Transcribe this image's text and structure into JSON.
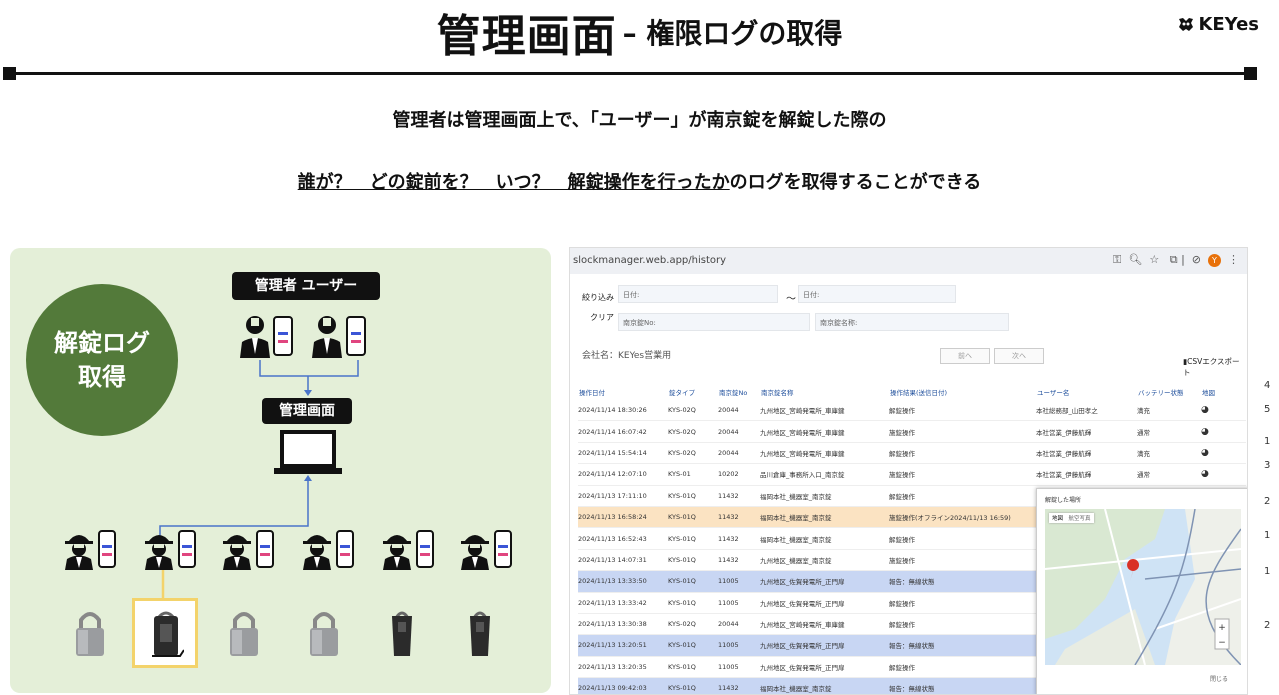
{
  "title": {
    "main": "管理画面",
    "sub": "– 権限ログの取得"
  },
  "brand": "KEYes",
  "intro": {
    "line1": "管理者は管理画面上で、「ユーザー」が南京錠を解錠した際の",
    "line2_underlined": "誰が？　どの錠前を？　いつ？　解錠操作を行ったか",
    "line2_rest": "のログを取得することができる"
  },
  "diagram": {
    "circle_line1": "解錠ログ",
    "circle_line2": "取得",
    "admin_label": "管理者 ユーザー",
    "screen_label": "管理画面"
  },
  "browser": {
    "url": "slockmanager.web.app/history",
    "avatar_letter": "Y",
    "filter_label": "絞り込み",
    "clear_label": "クリア",
    "date_label": "日付:",
    "tilde": "〜",
    "lock_no_label": "南京錠No:",
    "lock_name_label": "南京錠名称:",
    "company": "会社名：KEYes営業用",
    "prev": "前へ",
    "next": "次へ",
    "csv": "CSVエクスポート",
    "columns": [
      "操作日付",
      "錠タイプ",
      "南京錠No",
      "南京錠名称",
      "操作結果(送信日付)",
      "ユーザー名",
      "バッテリー状態",
      "地図"
    ],
    "rows": [
      {
        "date": "2024/11/14 18:30:26",
        "type": "KYS-02Q",
        "no": "20044",
        "name": "九州地区_宮崎発電所_車庫鍵",
        "result": "解錠操作",
        "user": "本社総務部_山田孝之",
        "battery": "満充",
        "style": ""
      },
      {
        "date": "2024/11/14 16:07:42",
        "type": "KYS-02Q",
        "no": "20044",
        "name": "九州地区_宮崎発電所_車庫鍵",
        "result": "施錠操作",
        "user": "本社営業_伊藤航輝",
        "battery": "通常",
        "style": ""
      },
      {
        "date": "2024/11/14 15:54:14",
        "type": "KYS-02Q",
        "no": "20044",
        "name": "九州地区_宮崎発電所_車庫鍵",
        "result": "解錠操作",
        "user": "本社営業_伊藤航輝",
        "battery": "満充",
        "style": ""
      },
      {
        "date": "2024/11/14 12:07:10",
        "type": "KYS-01",
        "no": "10202",
        "name": "品川倉庫_事務所入口_南京錠",
        "result": "施錠操作",
        "user": "本社営業_伊藤航輝",
        "battery": "通常",
        "style": ""
      },
      {
        "date": "2024/11/13 17:11:10",
        "type": "KYS-01Q",
        "no": "11432",
        "name": "福岡本社_機器室_南京錠",
        "result": "解錠操作",
        "user": "",
        "battery": "",
        "style": ""
      },
      {
        "date": "2024/11/13 16:58:24",
        "type": "KYS-01Q",
        "no": "11432",
        "name": "福岡本社_機器室_南京錠",
        "result": "施錠操作(オフライン2024/11/13 16:59)",
        "user": "",
        "battery": "",
        "style": "org"
      },
      {
        "date": "2024/11/13 16:52:43",
        "type": "KYS-01Q",
        "no": "11432",
        "name": "福岡本社_機器室_南京錠",
        "result": "解錠操作",
        "user": "",
        "battery": "",
        "style": ""
      },
      {
        "date": "2024/11/13 14:07:31",
        "type": "KYS-01Q",
        "no": "11432",
        "name": "九州地区_機器室_南京錠",
        "result": "施錠操作",
        "user": "",
        "battery": "",
        "style": ""
      },
      {
        "date": "2024/11/13 13:33:50",
        "type": "KYS-01Q",
        "no": "11005",
        "name": "九州地区_佐賀発電所_正門扉",
        "result": "報告：無線状態",
        "user": "",
        "battery": "",
        "style": "hl"
      },
      {
        "date": "2024/11/13 13:33:42",
        "type": "KYS-01Q",
        "no": "11005",
        "name": "九州地区_佐賀発電所_正門扉",
        "result": "解錠操作",
        "user": "",
        "battery": "",
        "style": ""
      },
      {
        "date": "2024/11/13 13:30:38",
        "type": "KYS-02Q",
        "no": "20044",
        "name": "九州地区_宮崎発電所_車庫鍵",
        "result": "解錠操作",
        "user": "",
        "battery": "",
        "style": ""
      },
      {
        "date": "2024/11/13 13:20:51",
        "type": "KYS-01Q",
        "no": "11005",
        "name": "九州地区_佐賀発電所_正門扉",
        "result": "報告：無線状態",
        "user": "",
        "battery": "",
        "style": "hl"
      },
      {
        "date": "2024/11/13 13:20:35",
        "type": "KYS-01Q",
        "no": "11005",
        "name": "九州地区_佐賀発電所_正門扉",
        "result": "解錠操作",
        "user": "",
        "battery": "",
        "style": ""
      },
      {
        "date": "2024/11/13 09:42:03",
        "type": "KYS-01Q",
        "no": "11432",
        "name": "福岡本社_機器室_南京錠",
        "result": "報告：無線状態",
        "user": "",
        "battery": "",
        "style": "hl"
      }
    ],
    "map_popup": {
      "title": "解錠した場所",
      "tab_map": "地図",
      "tab_satellite": "航空写真",
      "close": "閉じる"
    }
  },
  "right_edge_digits": [
    "4",
    "5",
    "1",
    "3",
    "2",
    "1",
    "1",
    "2"
  ]
}
